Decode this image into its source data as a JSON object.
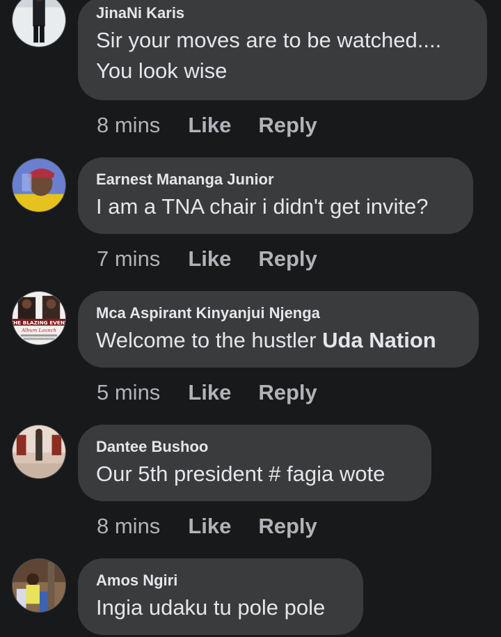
{
  "comments": [
    {
      "author": "JinaNi Karis",
      "text_lines": [
        "Sir your moves are to be watched....",
        "You look wise"
      ],
      "time": "8 mins",
      "like_label": "Like",
      "reply_label": "Reply",
      "avatar_icon": "person-standing-avatar"
    },
    {
      "author": "Earnest Mananga Junior",
      "text": "I am a TNA chair i didn't get invite?",
      "time": "7 mins",
      "like_label": "Like",
      "reply_label": "Reply",
      "avatar_icon": "man-in-cap-avatar"
    },
    {
      "author": "Mca Aspirant Kinyanjui Njenga",
      "text_prefix": "Welcome to the hustler ",
      "text_bold": "Uda Nation",
      "time": "5 mins",
      "like_label": "Like",
      "reply_label": "Reply",
      "avatar_icon": "event-poster-avatar",
      "avatar_poster_text": [
        "THE BLAZING EVENT",
        "Album Launch"
      ]
    },
    {
      "author": "Dantee Bushoo",
      "text": "Our 5th president # fagia wote",
      "time": "8 mins",
      "like_label": "Like",
      "reply_label": "Reply",
      "avatar_icon": "person-in-room-avatar"
    },
    {
      "author": "Amos Ngiri",
      "text": "Ingia udaku tu pole pole",
      "avatar_icon": "child-outdoors-avatar"
    }
  ],
  "colors": {
    "background": "#18191a",
    "bubble": "#3a3b3c",
    "primary_text": "#e4e6eb",
    "secondary_text": "#b0b3b8"
  }
}
